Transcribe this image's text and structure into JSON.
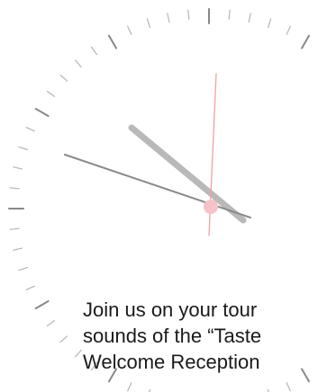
{
  "clock": {
    "colors": {
      "face": "#ffffff",
      "tick": "#b5b5b5",
      "tick_major": "#888888",
      "hour_hand": "#b9b9b9",
      "minute_hand": "#8a8a8a",
      "second_hand": "#f0a0a8",
      "center": "#f5c2c7"
    }
  },
  "caption": {
    "line1": "Join us on your tour",
    "line2": "sounds of the “Taste",
    "line3": "Welcome Reception"
  }
}
